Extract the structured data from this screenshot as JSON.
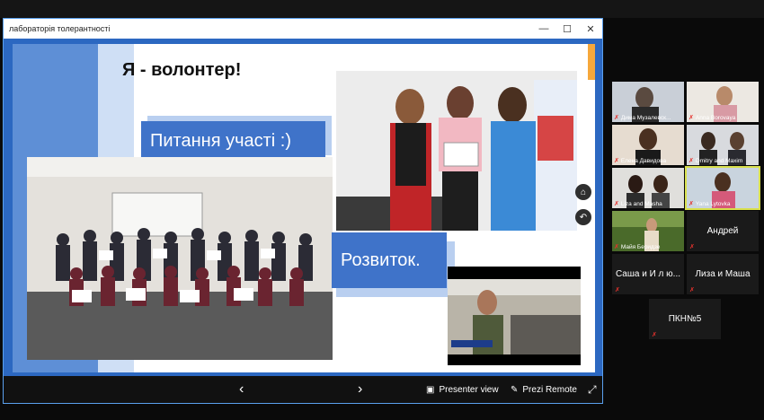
{
  "window": {
    "title": "лабораторія толерантності",
    "minimize": "—",
    "maximize": "☐",
    "close": "✕"
  },
  "slide": {
    "title": "Я - волонтер!",
    "label_participation": "Питання участі :)",
    "label_development": "Розвиток."
  },
  "controls": {
    "prev": "‹",
    "next": "›",
    "presenter_view": "Presenter view",
    "prezi_remote": "Prezi Remote",
    "fullscreen": "⤢"
  },
  "participants": [
    {
      "name": "Дима Музалевск..."
    },
    {
      "name": "Anna Borovaya"
    },
    {
      "name": "Елена Давидова"
    },
    {
      "name": "Dmitry and Maxim"
    },
    {
      "name": "Liza and Masha"
    },
    {
      "name": "Yana Lytovka"
    },
    {
      "name": "Майя Беридзе"
    },
    {
      "name": "Андрей"
    },
    {
      "name": "Саша и И л ю..."
    },
    {
      "name": "Лиза и Маша"
    },
    {
      "name": "ПКН№5"
    }
  ],
  "colors": {
    "accent": "#3f73c9",
    "active_speaker": "#d9e04c",
    "muted": "#e5322d"
  }
}
